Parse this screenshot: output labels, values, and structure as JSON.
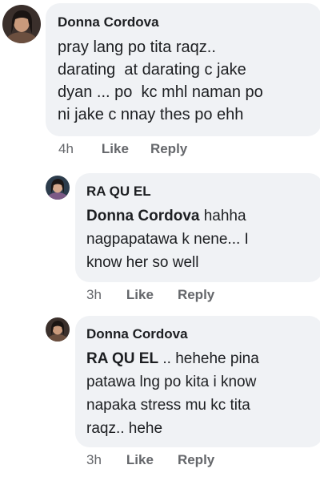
{
  "comments": [
    {
      "author": "Donna Cordova",
      "lines": [
        "pray lang po tita raqz..",
        "darating  at darating c jake",
        "dyan ... po  kc mhl naman po",
        "ni jake c nnay thes po ehh"
      ],
      "time": "4h",
      "like_label": "Like",
      "reply_label": "Reply"
    },
    {
      "author": "RA QU EL",
      "mention": "Donna Cordova",
      "lines": [
        " hahha",
        "nagpapatawa k nene... I",
        "know her so well"
      ],
      "time": "3h",
      "like_label": "Like",
      "reply_label": "Reply"
    },
    {
      "author": "Donna Cordova",
      "mention": "RA QU EL",
      "lines": [
        " .. hehehe pina",
        "patawa lng po kita i know",
        "napaka stress mu kc tita",
        "raqz.. hehe"
      ],
      "time": "3h",
      "like_label": "Like",
      "reply_label": "Reply"
    }
  ],
  "colors": {
    "bubble": "#f0f2f5",
    "text": "#1c1e21",
    "action": "#65676b"
  }
}
